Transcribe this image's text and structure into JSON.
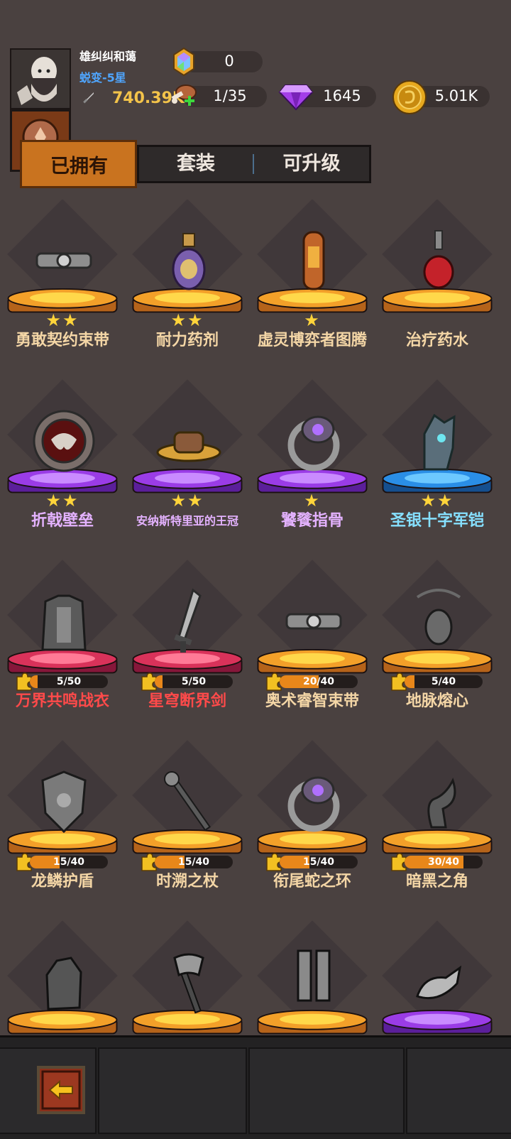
{
  "player": {
    "name": "雄纠纠和蔼",
    "rank": "蜕变-5星",
    "power": "740.39K"
  },
  "resources": [
    {
      "icon": "hexagon-gem-icon",
      "value": "0"
    },
    {
      "icon": "meat-stamina-icon",
      "value": "1/35"
    },
    {
      "icon": "purple-diamond-icon",
      "value": "1645"
    },
    {
      "icon": "gold-coin-icon",
      "value": "5.01K"
    }
  ],
  "tabs": {
    "owned": "已拥有",
    "sets": "套装",
    "upgradable": "可升级"
  },
  "colors": {
    "orange_pedestal": "#f3a029",
    "purple_pedestal": "#9a3ce6",
    "blue_pedestal": "#2a8ee6",
    "red_pedestal": "#d9325a",
    "star": "#ffd43a"
  },
  "items": [
    {
      "name": "勇敢契约束带",
      "pedestal": "orange",
      "stars": "★★",
      "icon": "belt-icon",
      "color": "orange"
    },
    {
      "name": "耐力药剂",
      "pedestal": "orange",
      "stars": "★★",
      "icon": "potion-flask-icon",
      "color": "orange"
    },
    {
      "name": "虚灵博弈者图腾",
      "pedestal": "orange",
      "stars": "★",
      "icon": "totem-icon",
      "color": "orange"
    },
    {
      "name": "治疗药水",
      "pedestal": "orange",
      "stars": "",
      "icon": "red-potion-icon",
      "color": "orange"
    },
    {
      "name": "折戟壁垒",
      "pedestal": "purple",
      "stars": "★★",
      "icon": "spiked-shield-icon",
      "color": "purple"
    },
    {
      "name": "安纳斯特里亚的王冠",
      "pedestal": "purple",
      "stars": "★★",
      "icon": "hat-icon",
      "color": "purple",
      "small": true
    },
    {
      "name": "饕餮指骨",
      "pedestal": "purple",
      "stars": "★",
      "icon": "ring-icon",
      "color": "purple"
    },
    {
      "name": "圣银十字军铠",
      "pedestal": "blue",
      "stars": "★★",
      "icon": "gauntlet-icon",
      "color": "blue"
    },
    {
      "name": "万界共鸣战衣",
      "pedestal": "red",
      "progress": "5/50",
      "fraction": 0.1,
      "icon": "armor-icon",
      "color": "red"
    },
    {
      "name": "星穹断界剑",
      "pedestal": "red",
      "progress": "5/50",
      "fraction": 0.1,
      "icon": "sword-icon",
      "color": "red"
    },
    {
      "name": "奥术睿智束带",
      "pedestal": "orange",
      "progress": "20/40",
      "fraction": 0.5,
      "icon": "belt-icon",
      "color": "orange"
    },
    {
      "name": "地脉熔心",
      "pedestal": "orange",
      "progress": "5/40",
      "fraction": 0.125,
      "icon": "amulet-icon",
      "color": "orange"
    },
    {
      "name": "龙鳞护盾",
      "pedestal": "orange",
      "progress": "15/40",
      "fraction": 0.375,
      "icon": "shield-icon",
      "color": "orange"
    },
    {
      "name": "时溯之杖",
      "pedestal": "orange",
      "progress": "15/40",
      "fraction": 0.375,
      "icon": "staff-icon",
      "color": "orange"
    },
    {
      "name": "衔尾蛇之环",
      "pedestal": "orange",
      "progress": "15/40",
      "fraction": 0.375,
      "icon": "ring-icon",
      "color": "orange"
    },
    {
      "name": "暗黑之角",
      "pedestal": "orange",
      "progress": "30/40",
      "fraction": 0.75,
      "icon": "horn-icon",
      "color": "orange"
    },
    {
      "name": "",
      "pedestal": "orange",
      "icon": "claw-gauntlet-icon",
      "color": "orange"
    },
    {
      "name": "",
      "pedestal": "orange",
      "icon": "axe-icon",
      "color": "orange"
    },
    {
      "name": "",
      "pedestal": "orange",
      "icon": "greaves-icon",
      "color": "orange"
    },
    {
      "name": "",
      "pedestal": "purple",
      "icon": "claw-icon",
      "color": "purple"
    }
  ]
}
